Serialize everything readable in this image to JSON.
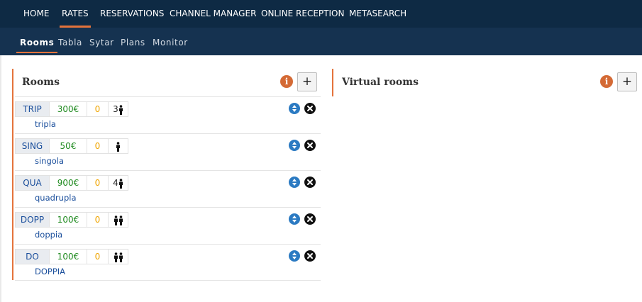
{
  "nav": {
    "items": [
      "HOME",
      "RATES",
      "RESERVATIONS",
      "CHANNEL MANAGER",
      "ONLINE RECEPTION",
      "METASEARCH"
    ],
    "active": "RATES"
  },
  "subnav": {
    "items": [
      "Rooms",
      "Tabla",
      "Sytar",
      "Plans",
      "Monitor"
    ],
    "active": "Rooms"
  },
  "rooms_panel": {
    "title": "Rooms",
    "info_icon": "info-icon",
    "add_label": "+",
    "rows": [
      {
        "code": "TRIP",
        "price": "300€",
        "available": "0",
        "occupancy_number": "3",
        "persons": 1,
        "name": "tripla"
      },
      {
        "code": "SING",
        "price": "50€",
        "available": "0",
        "occupancy_number": "",
        "persons": 1,
        "name": "singola"
      },
      {
        "code": "QUA",
        "price": "900€",
        "available": "0",
        "occupancy_number": "4",
        "persons": 1,
        "name": "quadrupla"
      },
      {
        "code": "DOPP",
        "price": "100€",
        "available": "0",
        "occupancy_number": "",
        "persons": 2,
        "name": "doppia"
      },
      {
        "code": "DO",
        "price": "100€",
        "available": "0",
        "occupancy_number": "",
        "persons": 2,
        "name": "DOPPIA"
      }
    ]
  },
  "virtual_panel": {
    "title": "Virtual rooms",
    "info_icon": "info-icon",
    "add_label": "+"
  },
  "colors": {
    "nav_bg": "#0e2a44",
    "subnav_bg": "#153250",
    "accent": "#e4733b",
    "price": "#1f8a1f",
    "available": "#f0a500",
    "link": "#1b4f9c"
  }
}
